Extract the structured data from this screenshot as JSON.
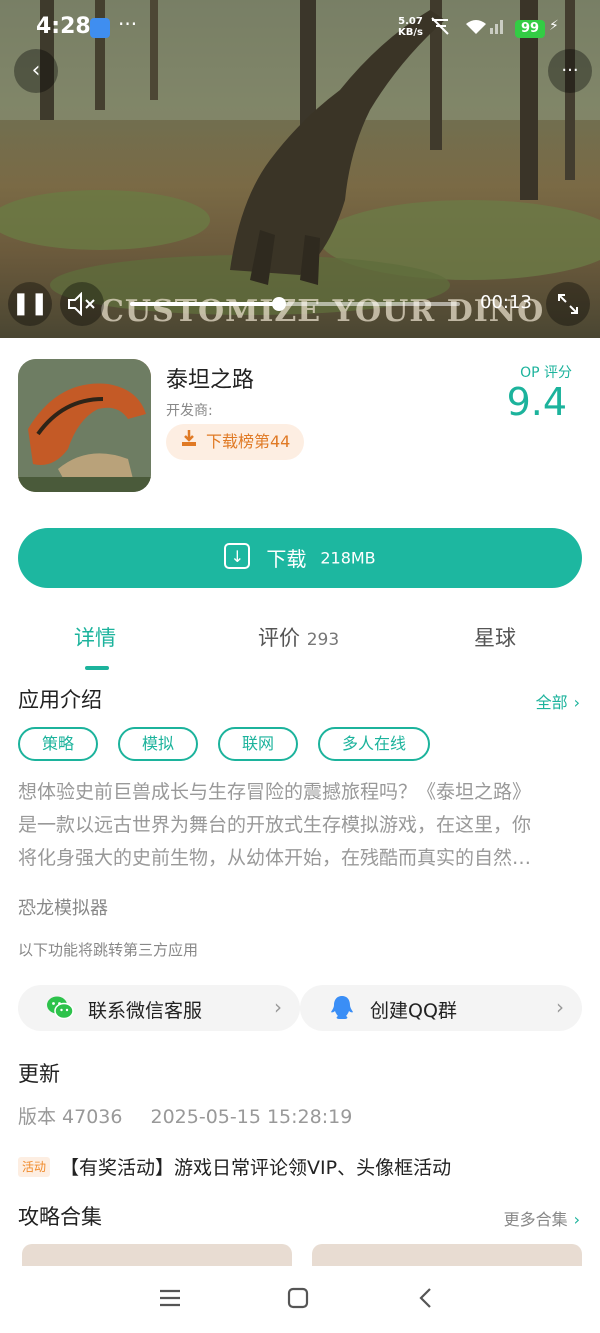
{
  "status_bar": {
    "time": "4:28",
    "overflow": "···",
    "net_speed_value": "5.07",
    "net_speed_unit": "KB/s",
    "battery": "99"
  },
  "video": {
    "caption": "CUSTOMIZE YOUR DINO",
    "elapsed": "00:13",
    "progress": 0.45
  },
  "app": {
    "name": "泰坦之路",
    "developer_label": "开发商:",
    "rank_label": "下载榜第44",
    "score_label": "OP 评分",
    "score": "9.4"
  },
  "download": {
    "label": "下载",
    "size": "218MB"
  },
  "tabs": [
    {
      "label": "详情",
      "count": ""
    },
    {
      "label": "评价",
      "count": "293"
    },
    {
      "label": "星球",
      "count": ""
    }
  ],
  "intro": {
    "title": "应用介绍",
    "all_label": "全部",
    "tags": [
      "策略",
      "模拟",
      "联网",
      "多人在线"
    ],
    "description_lines": [
      "想体验史前巨兽成长与生存冒险的震撼旅程吗？《泰坦之路》",
      "是一款以远古世界为舞台的开放式生存模拟游戏，在这里，你",
      "将化身强大的史前生物，从幼体开始，在残酷而真实的自然…"
    ],
    "sub_category": "恐龙模拟器",
    "third_party_note": "以下功能将跳转第三方应用"
  },
  "links": [
    {
      "label": "联系微信客服",
      "icon": "wechat-icon",
      "color": "#2dc24b"
    },
    {
      "label": "创建QQ群",
      "icon": "qq-icon",
      "color": "#3a8ef6"
    }
  ],
  "update": {
    "title": "更新",
    "version": "版本 47036",
    "date": "2025-05-15 15:28:19"
  },
  "event": {
    "badge": "活动",
    "text": "【有奖活动】游戏日常评论领VIP、头像框活动"
  },
  "guides": {
    "title": "攻略合集",
    "more_label": "更多合集"
  },
  "colors": {
    "accent": "#1cb39c",
    "download_button": "#1db7a0",
    "rank_text": "#e07a25"
  }
}
